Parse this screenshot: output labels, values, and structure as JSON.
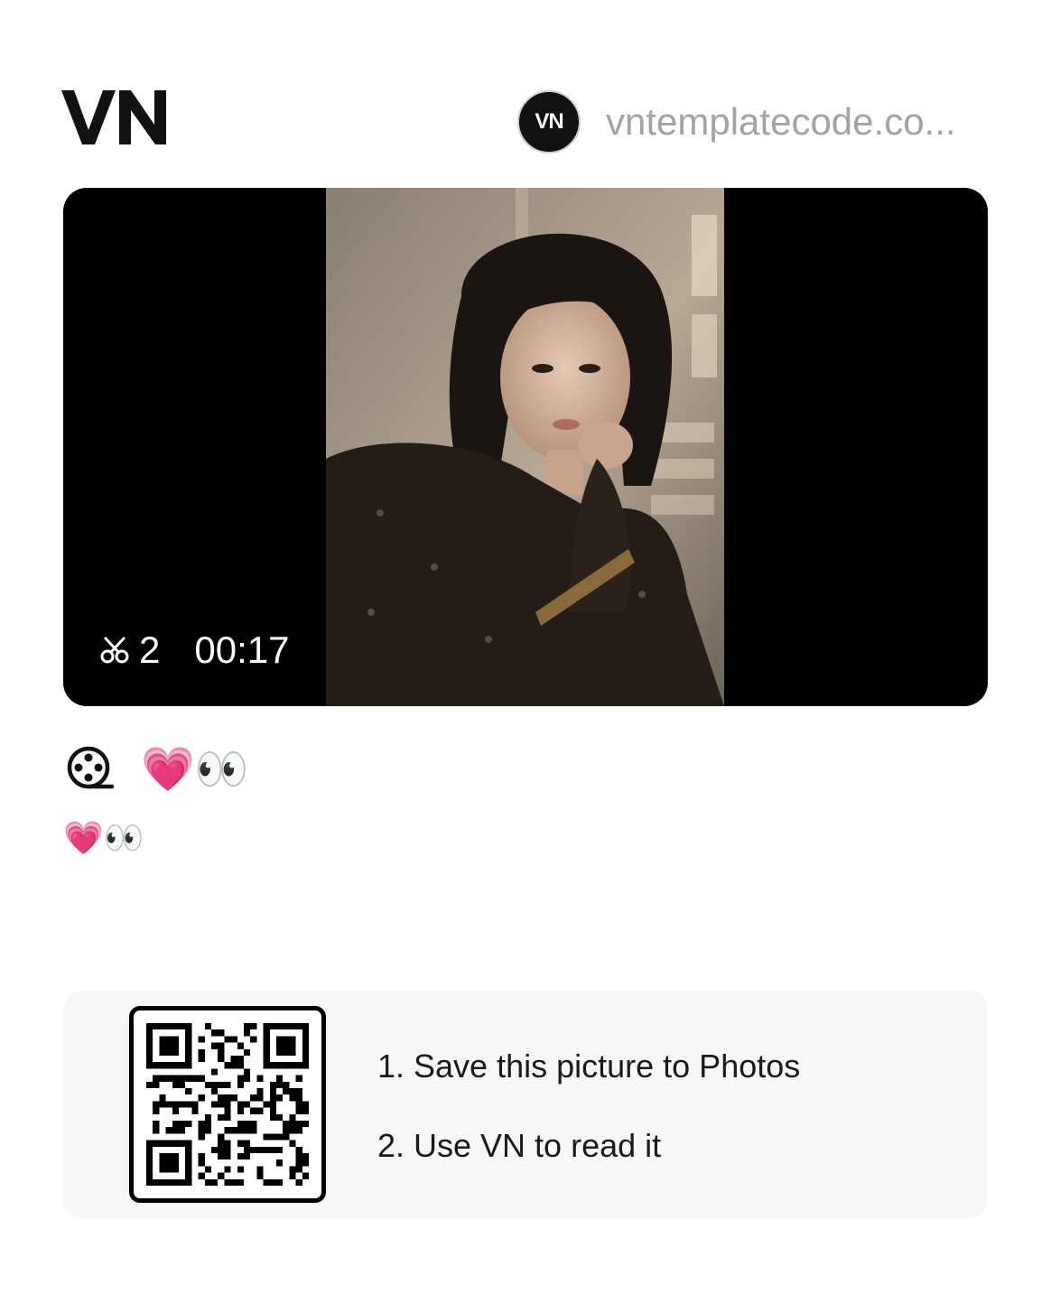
{
  "header": {
    "logo_text": "VN",
    "author": {
      "avatar_text": "VN",
      "name": "vntemplatecode.co..."
    }
  },
  "preview": {
    "clips": "2",
    "duration": "00:17",
    "icons": {
      "scissors": "scissors-icon",
      "photo": "photo-thumbnail"
    }
  },
  "template": {
    "title": "💗👀",
    "description": "💗👀",
    "title_icon": "film-reel-icon"
  },
  "qr_card": {
    "steps": [
      "1. Save this picture to Photos",
      "2. Use VN to read it"
    ]
  },
  "colors": {
    "background": "#ffffff",
    "card_background": "#f7f7f7",
    "author_text": "#a3a3a3",
    "preview_background": "#000000"
  }
}
